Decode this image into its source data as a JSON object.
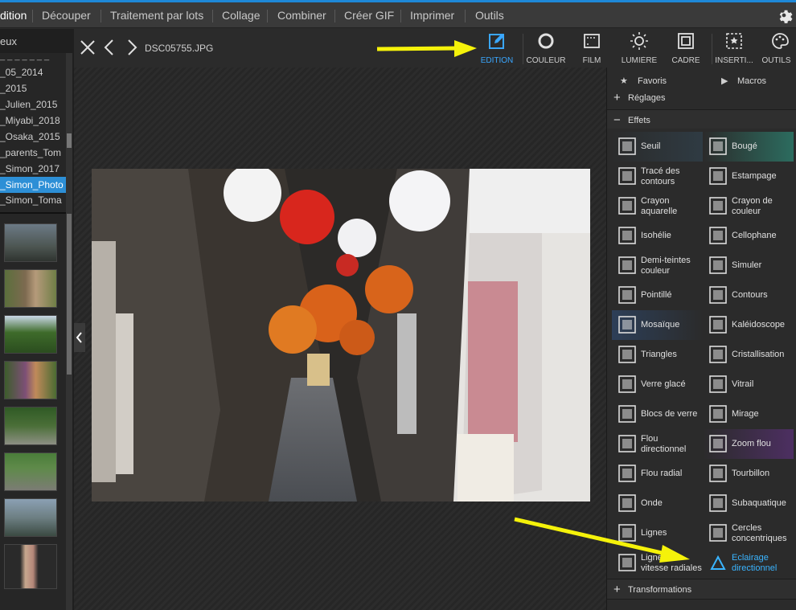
{
  "menu": {
    "items": [
      "dition",
      "Découper",
      "Traitement par lots",
      "Collage",
      "Combiner",
      "Créer GIF",
      "Imprimer",
      "Outils"
    ],
    "active_index": 0,
    "settings_icon": "gear-icon"
  },
  "left_panel": {
    "header": "eux",
    "folders": [
      "_05_2014",
      "_2015",
      "_Julien_2015",
      "_Miyabi_2018",
      "_Osaka_2015",
      "_parents_Tom",
      "_Simon_2017",
      "_Simon_Photo",
      "_Simon_Toma"
    ],
    "selected_folder_index": 7,
    "thumbnails": [
      "thumb-1",
      "thumb-2",
      "thumb-3",
      "thumb-4",
      "thumb-5",
      "thumb-6",
      "thumb-7",
      "thumb-8"
    ]
  },
  "toolbar": {
    "filename": "DSC05755.JPG",
    "close_icon": "close-icon",
    "prev_icon": "chevron-left-icon",
    "next_icon": "chevron-right-icon"
  },
  "modes": [
    {
      "label": "EDITION",
      "icon": "edit-icon",
      "active": true
    },
    {
      "label": "COULEUR",
      "icon": "circle-icon",
      "active": false
    },
    {
      "label": "FILM",
      "icon": "film-icon",
      "active": false
    },
    {
      "label": "LUMIÈRE",
      "icon": "sun-icon",
      "active": false
    },
    {
      "label": "CADRE",
      "icon": "frame-icon",
      "active": false
    },
    {
      "label": "INSERTI...",
      "icon": "insert-icon",
      "active": false
    },
    {
      "label": "OUTILS",
      "icon": "palette-icon",
      "active": false
    }
  ],
  "right_panel": {
    "favoris": "Favoris",
    "macros": "Macros",
    "reglages": "Réglages",
    "effets": "Effets",
    "transformations": "Transformations",
    "effects": [
      {
        "label": "Seuil",
        "icon": "threshold-icon"
      },
      {
        "label": "Bougé",
        "icon": "shake-icon"
      },
      {
        "label": "Tracé des contours",
        "icon": "trace-contours-icon"
      },
      {
        "label": "Estampage",
        "icon": "emboss-icon"
      },
      {
        "label": "Crayon aquarelle",
        "icon": "watercolor-icon"
      },
      {
        "label": "Crayon de couleur",
        "icon": "pencil-icon"
      },
      {
        "label": "Isohélie",
        "icon": "posterize-icon"
      },
      {
        "label": "Cellophane",
        "icon": "cellophane-icon"
      },
      {
        "label": "Demi-teintes couleur",
        "icon": "halftone-icon"
      },
      {
        "label": "Simuler",
        "icon": "simulate-icon"
      },
      {
        "label": "Pointillé",
        "icon": "pointillism-icon"
      },
      {
        "label": "Contours",
        "icon": "contours-icon"
      },
      {
        "label": "Mosaïque",
        "icon": "mosaic-icon"
      },
      {
        "label": "Kaléidoscope",
        "icon": "kaleidoscope-icon"
      },
      {
        "label": "Triangles",
        "icon": "triangles-icon"
      },
      {
        "label": "Cristallisation",
        "icon": "crystallize-icon"
      },
      {
        "label": "Verre glacé",
        "icon": "frosted-glass-icon"
      },
      {
        "label": "Vitrail",
        "icon": "stained-glass-icon"
      },
      {
        "label": "Blocs de verre",
        "icon": "glass-blocks-icon"
      },
      {
        "label": "Mirage",
        "icon": "mirage-icon"
      },
      {
        "label": "Flou directionnel",
        "icon": "directional-blur-icon"
      },
      {
        "label": "Zoom flou",
        "icon": "zoom-blur-icon"
      },
      {
        "label": "Flou radial",
        "icon": "radial-blur-icon"
      },
      {
        "label": "Tourbillon",
        "icon": "swirl-icon"
      },
      {
        "label": "Onde",
        "icon": "wave-icon"
      },
      {
        "label": "Subaquatique",
        "icon": "underwater-icon"
      },
      {
        "label": "Lignes",
        "icon": "lines-icon"
      },
      {
        "label": "Cercles concentriques",
        "icon": "concentric-circles-icon"
      },
      {
        "label": "Lignes de vitesse radiales",
        "icon": "radial-speed-lines-icon"
      },
      {
        "label": "Eclairage directionnel",
        "icon": "directional-light-icon"
      }
    ],
    "highlighted_effect_index": 29
  },
  "colors": {
    "accent": "#2d8fd6",
    "highlight_text": "#3ab4ff",
    "arrow": "#f5f20a"
  }
}
